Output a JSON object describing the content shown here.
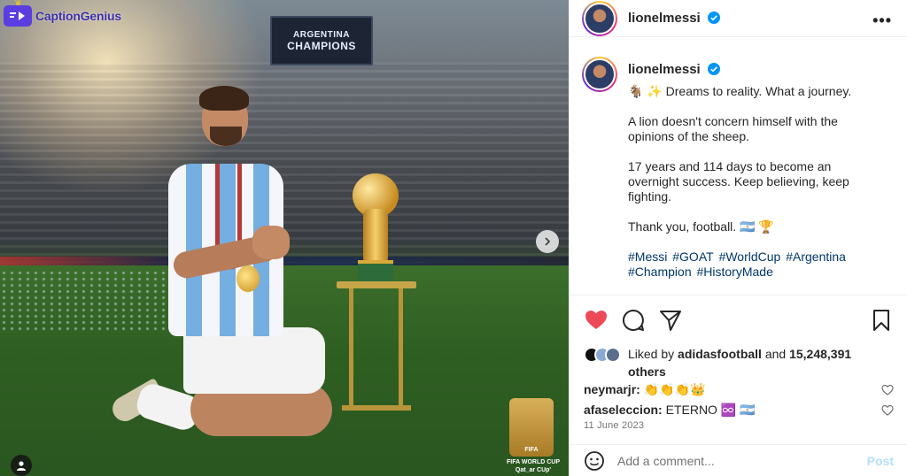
{
  "watermark": {
    "brand": "CaptionGenius"
  },
  "photo": {
    "scoreboard_line1": "ARGENTINA",
    "scoreboard_line2": "CHAMPIONS",
    "badge_text": "FIFA",
    "badge_caption_line1": "FIFA WORLD CUP",
    "badge_caption_line2": "Qat_ar CUp'"
  },
  "post": {
    "username": "lionelmessi",
    "caption": {
      "line1": "✨ Dreams to reality. What a journey.",
      "para2_line1": "A lion doesn't concern himself with the",
      "para2_line2": "opinions of the sheep.",
      "para3_line1": "17 years and 114 days to become an",
      "para3_line2": "overnight success. Keep believing, keep",
      "para3_line3": "fighting.",
      "para4": "Thank you, football. 🇦🇷 🏆"
    },
    "hashtags": [
      "#Messi",
      "#GOAT",
      "#WorldCup",
      "#Argentina",
      "#Champion",
      "#HistoryMade"
    ],
    "likes": {
      "prefix": "Liked by",
      "by_user": "adidasfootball",
      "and": "and",
      "count": "15,248,391",
      "others": "others"
    },
    "comments": [
      {
        "user": "neymarjr:",
        "text": "👏👏👏👑"
      },
      {
        "user": "afaseleccion:",
        "text": "ETERNO ♾️ 🇦🇷"
      }
    ],
    "date": "11 June 2023",
    "add_comment_placeholder": "Add a comment...",
    "post_label": "Post"
  },
  "colors": {
    "like_red": "#ed4956",
    "verified_blue": "#0095f6",
    "hashtag_blue": "#00376b",
    "post_disabled": "#b2dffc"
  }
}
